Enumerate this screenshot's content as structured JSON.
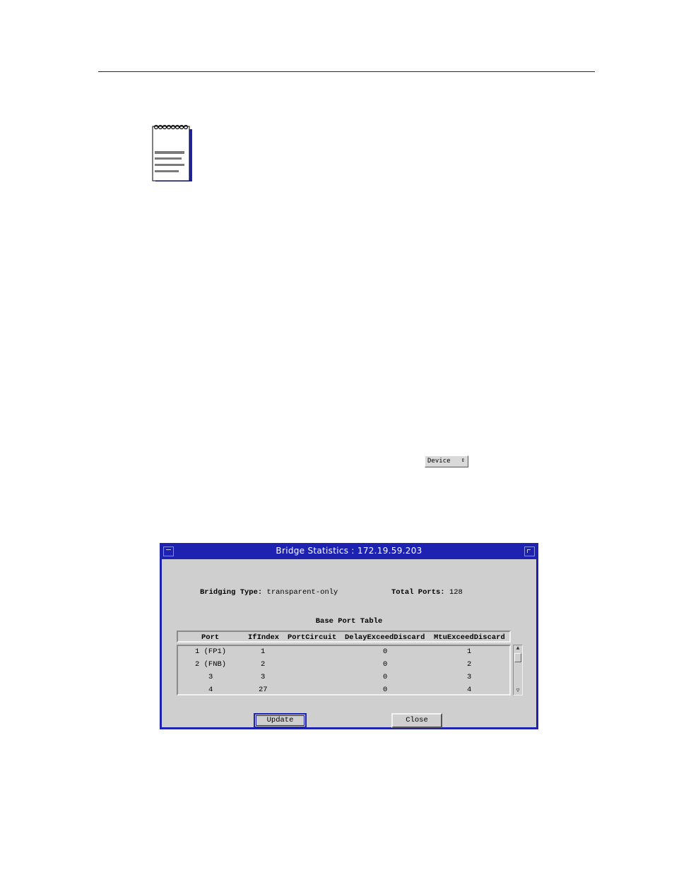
{
  "device_menu": {
    "label": "Device",
    "arrow": "⇕"
  },
  "window": {
    "title": "Bridge Statistics : 172.19.59.203",
    "bridging_type_label": "Bridging Type:",
    "bridging_type_value": "transparent-only",
    "total_ports_label": "Total Ports:",
    "total_ports_value": "128",
    "table_title": "Base Port Table",
    "columns": [
      "Port",
      "IfIndex",
      "PortCircuit",
      "DelayExceedDiscard",
      "MtuExceedDiscard"
    ],
    "rows": [
      {
        "port": "1 (FP1)",
        "ifindex": "1",
        "circuit": "",
        "delay": "0",
        "mtu": "1"
      },
      {
        "port": "2 (FNB)",
        "ifindex": "2",
        "circuit": "",
        "delay": "0",
        "mtu": "2"
      },
      {
        "port": "3",
        "ifindex": "3",
        "circuit": "",
        "delay": "0",
        "mtu": "3"
      },
      {
        "port": "4",
        "ifindex": "27",
        "circuit": "",
        "delay": "0",
        "mtu": "4"
      }
    ],
    "update_label": "Update",
    "close_label": "Close"
  },
  "colors": {
    "title_bar": "#1e22b0",
    "rule": "#1a1aa6",
    "dialog_bg": "#cfcfcf"
  },
  "icons": [
    "notepad-icon",
    "scroll-up-icon",
    "scroll-down-icon"
  ]
}
